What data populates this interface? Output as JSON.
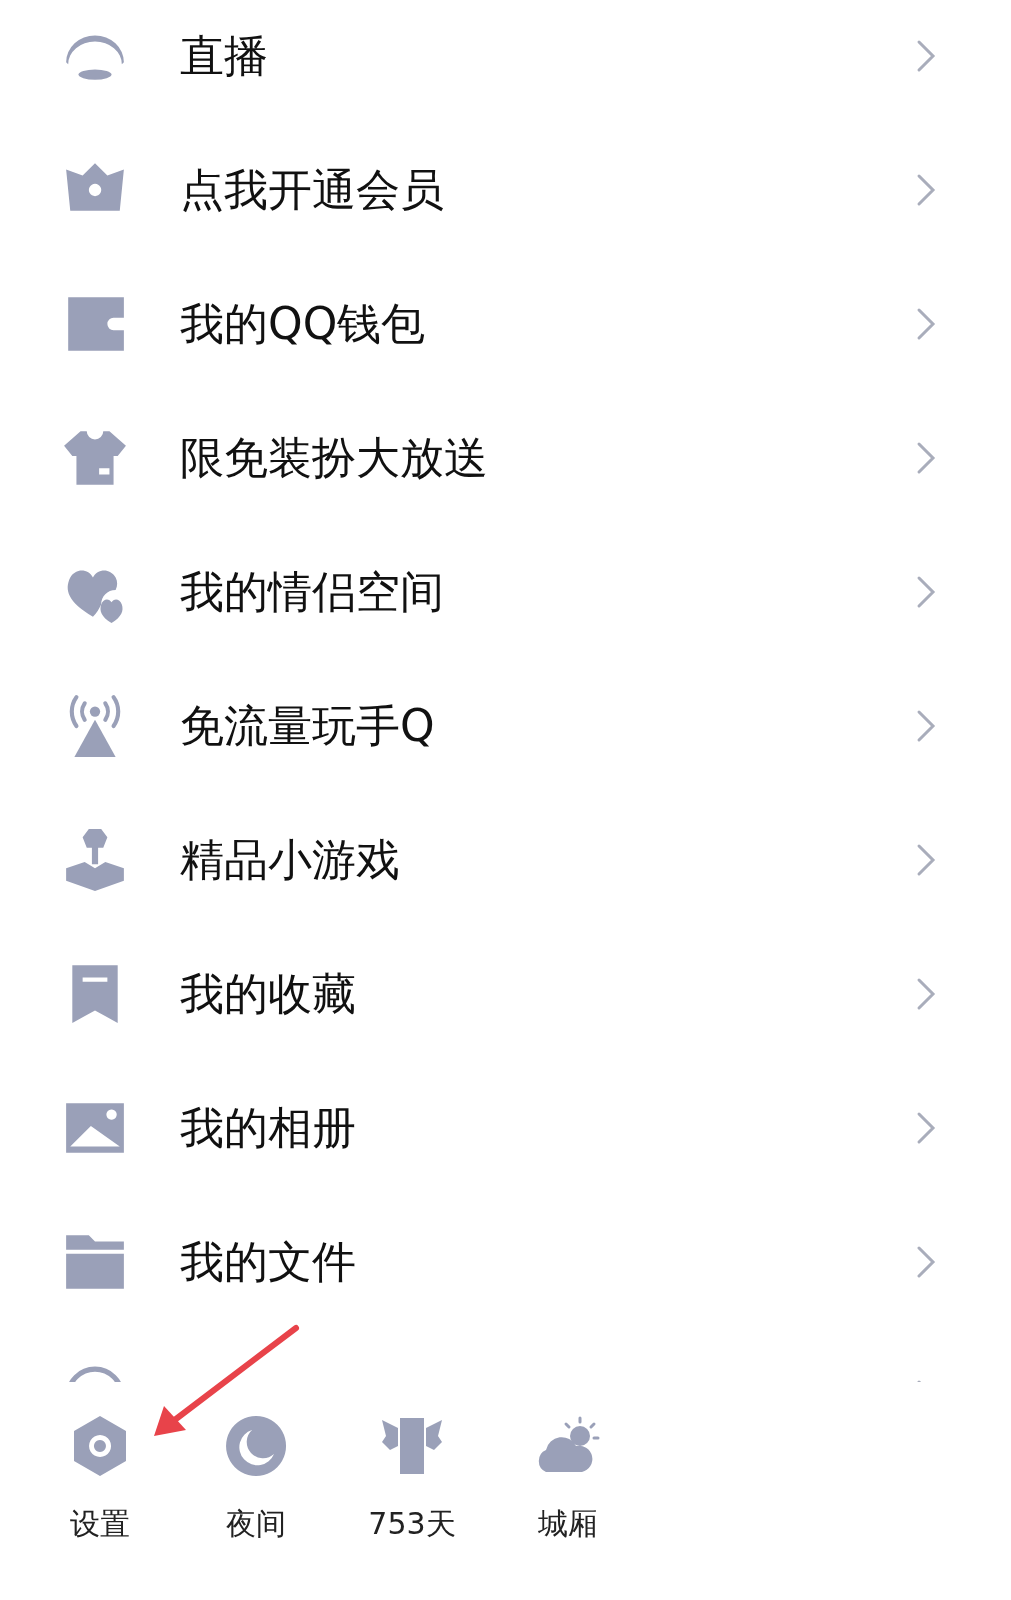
{
  "menu": [
    {
      "kind": "live",
      "label": "直播"
    },
    {
      "kind": "crown",
      "label": "点我开通会员"
    },
    {
      "kind": "wallet",
      "label": "我的QQ钱包"
    },
    {
      "kind": "shirt",
      "label": "限免装扮大放送"
    },
    {
      "kind": "hearts",
      "label": "我的情侣空间"
    },
    {
      "kind": "tower",
      "label": "免流量玩手Q"
    },
    {
      "kind": "joystick",
      "label": "精品小游戏"
    },
    {
      "kind": "bookmark",
      "label": "我的收藏"
    },
    {
      "kind": "image",
      "label": "我的相册"
    },
    {
      "kind": "folder",
      "label": "我的文件"
    },
    {
      "kind": "face"
    }
  ],
  "bottom_bar": [
    {
      "kind": "gear",
      "label": "设置"
    },
    {
      "kind": "moon",
      "label": "夜间"
    },
    {
      "kind": "wings",
      "label": "753天"
    },
    {
      "kind": "weather",
      "label": "城厢"
    }
  ]
}
